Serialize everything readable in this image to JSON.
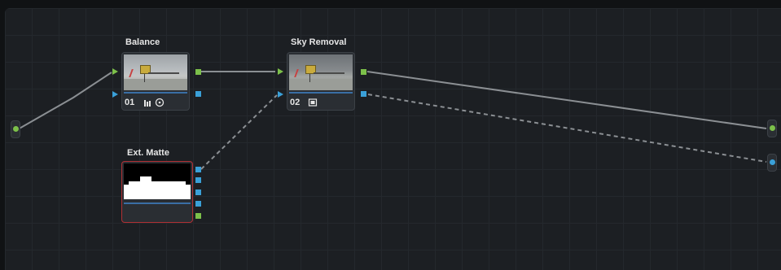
{
  "graph": {
    "nodes": [
      {
        "title": "Balance",
        "number": "01",
        "icons": [
          "levels-icon",
          "circle-dot-icon"
        ]
      },
      {
        "title": "Sky Removal",
        "number": "02",
        "icons": [
          "mask-icon"
        ]
      },
      {
        "title": "Ext. Matte"
      }
    ]
  },
  "colors": {
    "rgb_port": "#7cc04a",
    "key_port": "#3aa0d8",
    "matte_border": "#b03034"
  }
}
